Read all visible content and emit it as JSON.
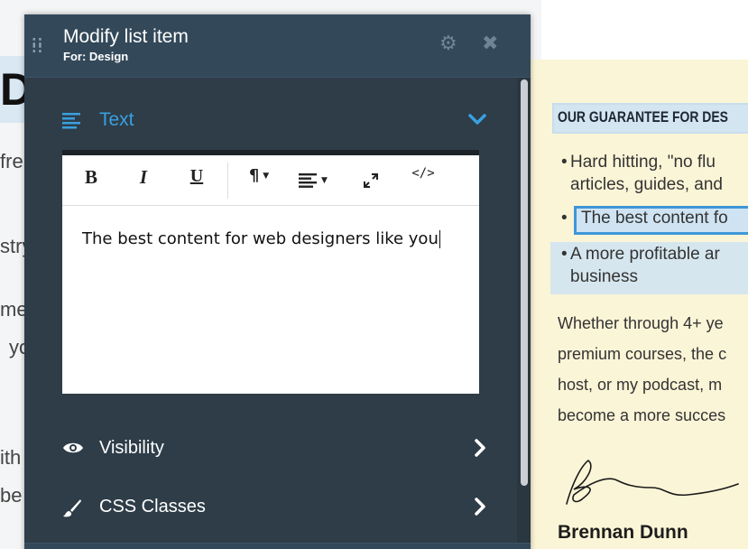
{
  "panel": {
    "title": "Modify list item",
    "subtitle": "For: Design",
    "icons": {
      "drag": "drag-handle-icon",
      "settings": "gear-icon",
      "close": "close-icon"
    },
    "section": {
      "label": "Text",
      "icon": "text-align-icon",
      "state": "expanded"
    },
    "toolbar": {
      "bold": "B",
      "italic": "I",
      "underline": "U",
      "paragraph": "¶",
      "align": "align-left-icon",
      "fullscreen": "expand-icon",
      "code": "</>"
    },
    "editor_text": "The best content for web designers like you",
    "rows": [
      {
        "label": "Visibility",
        "icon": "eye-icon"
      },
      {
        "label": "CSS Classes",
        "icon": "paintbrush-icon"
      }
    ]
  },
  "left_page": {
    "heading": "D",
    "fragments": [
      "fre",
      "stry",
      "me",
      "yo",
      "ith",
      "be"
    ]
  },
  "right_page": {
    "guarantee": "OUR GUARANTEE FOR DES",
    "bullets": [
      {
        "lines": [
          "Hard hitting, \"no flu",
          "articles, guides, and"
        ]
      },
      {
        "lines": [
          "The best content fo"
        ]
      },
      {
        "lines": [
          "A more profitable ar",
          "business"
        ]
      }
    ],
    "paragraph": [
      "Whether through 4+ ye",
      "premium courses, the c",
      "host, or my podcast, m",
      "become a more succes"
    ],
    "author": "Brennan Dunn"
  },
  "colors": {
    "panel_bg": "#2e3d48",
    "accent": "#3aa0e0",
    "page_bg": "#fbf5d7"
  }
}
